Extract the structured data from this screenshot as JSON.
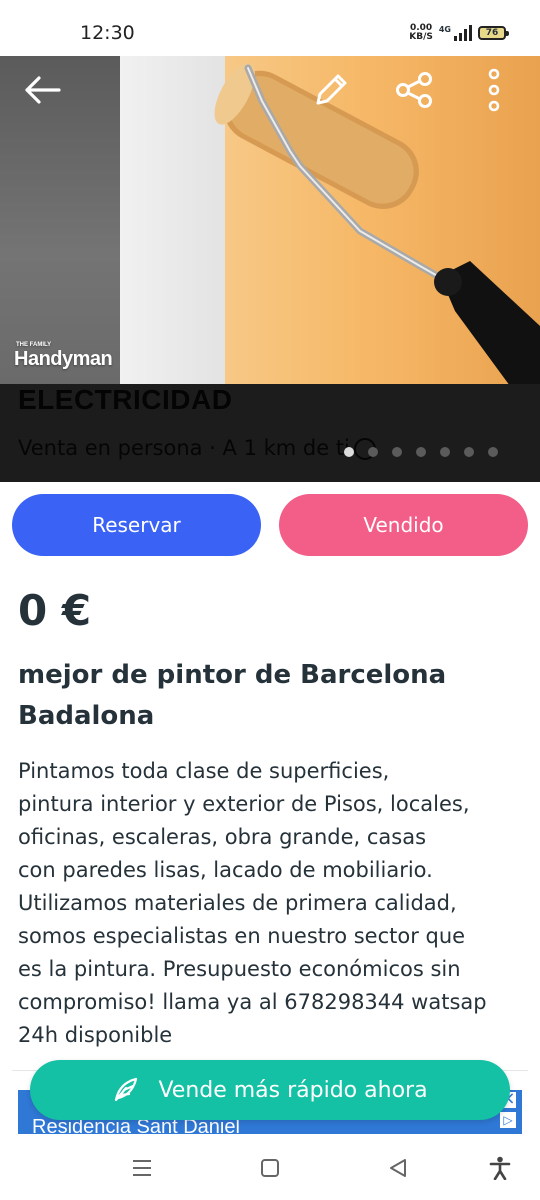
{
  "status_bar": {
    "time": "12:30",
    "net_speed_value": "0.00",
    "net_speed_unit": "KB/S",
    "network_type": "4G",
    "battery_level": "76"
  },
  "hero": {
    "watermark": "Handyman",
    "watermark_small": "THE FAMILY",
    "overlay_title": "ELECTRICIDAD",
    "overlay_subtitle": "Venta en persona · A 1 km de ti",
    "image_count": 7,
    "active_image_index": 0
  },
  "actions": {
    "reserve_label": "Reservar",
    "sold_label": "Vendido"
  },
  "listing": {
    "price": "0 €",
    "title": "mejor de pintor de Barcelona Badalona",
    "description": "Pintamos toda clase de superficies,\npintura interior y exterior de Pisos, locales,\noficinas, escaleras, obra grande, casas\ncon paredes lisas, lacado de mobiliario.\nUtilizamos materiales de primera calidad,\nsomos especialistas en nuestro sector que\nes la pintura. Presupuesto económicos sin\ncompromiso! llama ya al 678298344 watsap\n24h disponible"
  },
  "fab": {
    "label": "Vende más rápido ahora"
  },
  "ad": {
    "text": "Residencia Sant Daniel",
    "close": "×",
    "info": "▷"
  },
  "colors": {
    "reserve": "#3a63f5",
    "sold": "#f25e88",
    "fab": "#14c1a4",
    "text": "#26323a"
  }
}
